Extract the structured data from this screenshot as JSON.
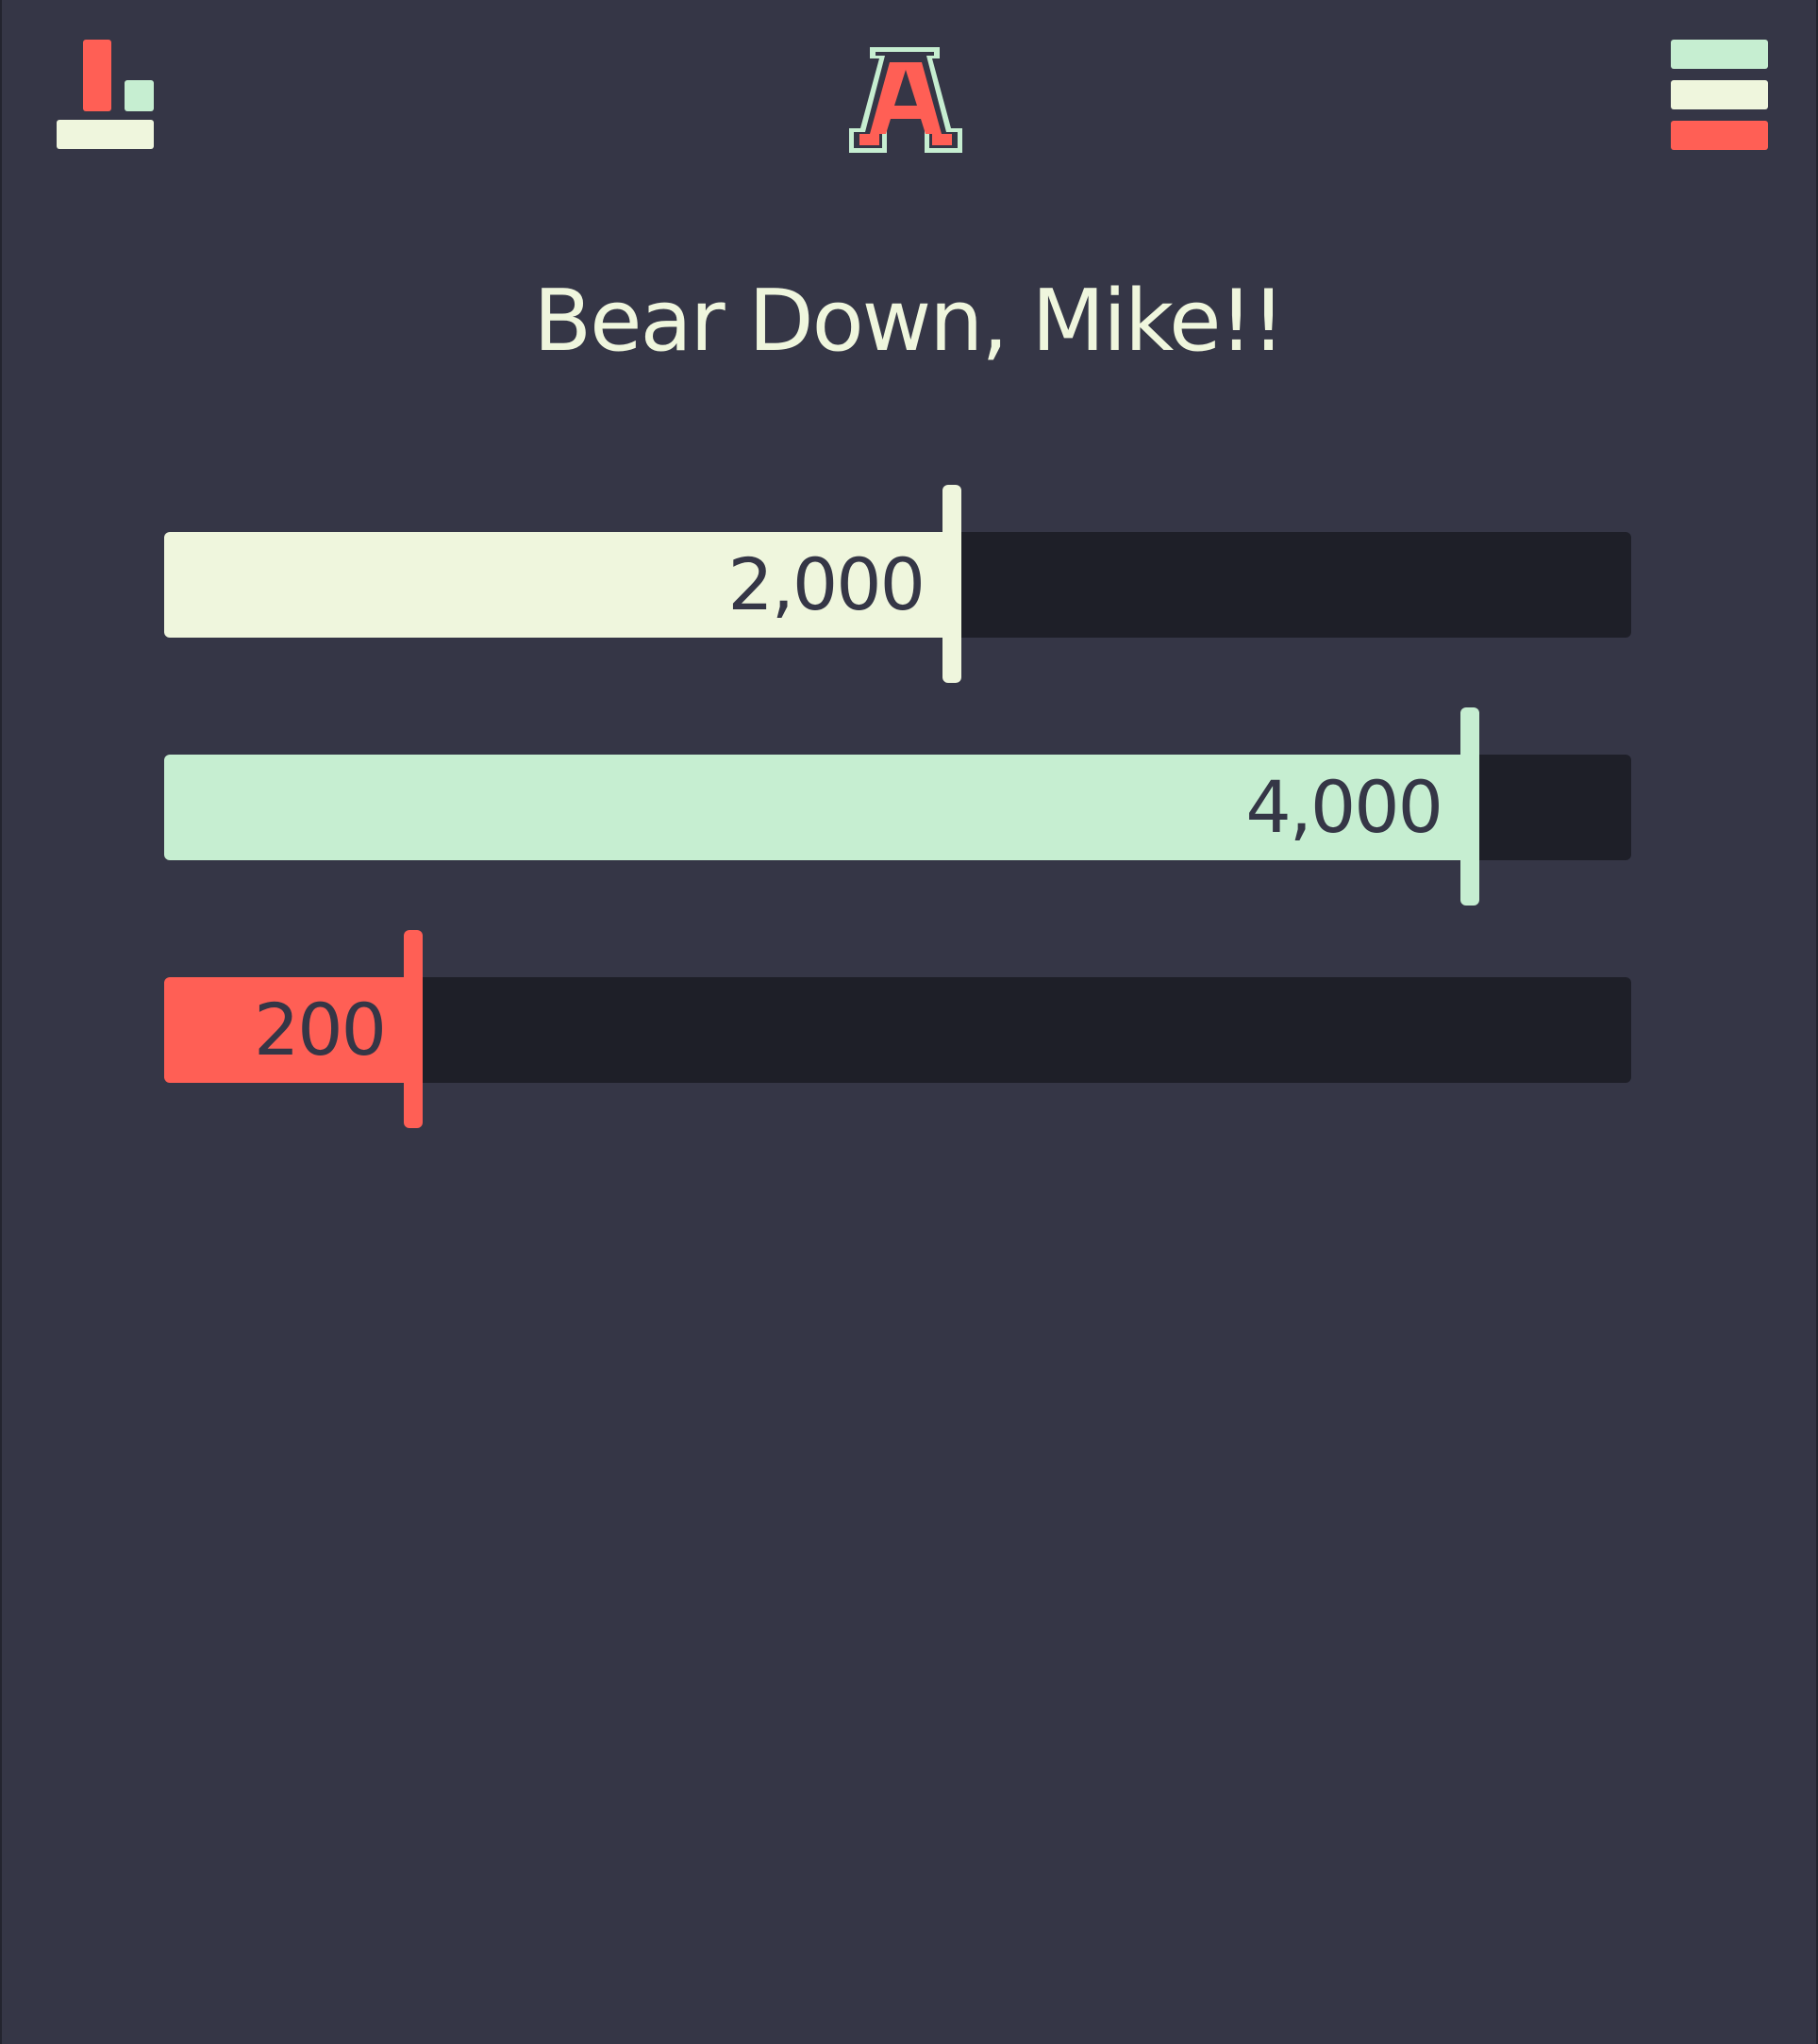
{
  "header": {
    "stats_icon": "bar-chart-icon",
    "logo_icon": "block-a-logo",
    "logo_letter": "A",
    "menu_icon": "hamburger-menu-icon"
  },
  "greeting": "Bear Down, Mike!!",
  "colors": {
    "background": "#353646",
    "track": "#1e1f28",
    "cream": "#eff6dd",
    "mint": "#c6eed1",
    "coral": "#ff5f55"
  },
  "bars": [
    {
      "label": "2,000",
      "value": 2000,
      "max_value": 4000,
      "progress_fraction": 0.537,
      "color": "#eff6dd"
    },
    {
      "label": "4,000",
      "value": 4000,
      "max_value": 4000,
      "progress_fraction": 0.89,
      "color": "#c6eed1"
    },
    {
      "label": "200",
      "value": 200,
      "max_value": 4000,
      "progress_fraction": 0.17,
      "color": "#ff5f55"
    }
  ]
}
